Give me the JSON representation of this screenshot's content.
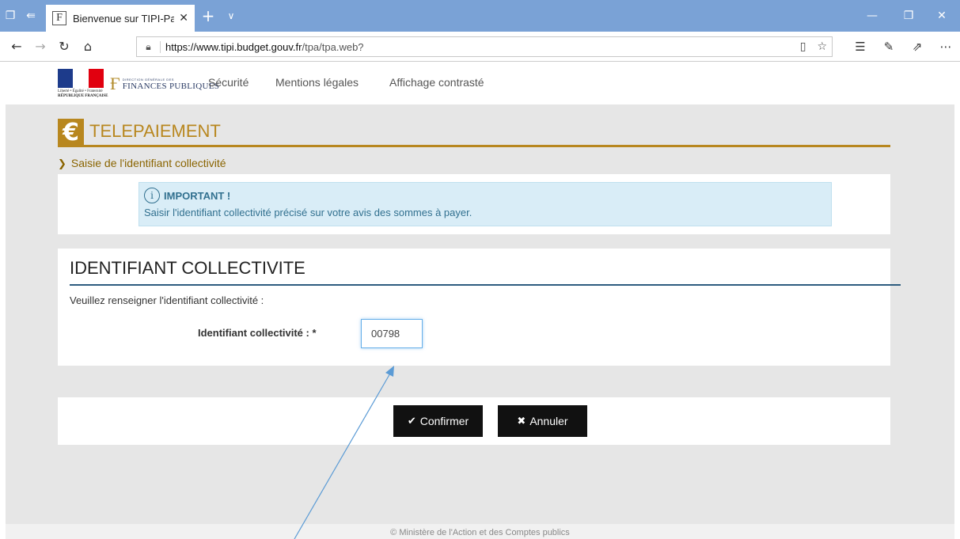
{
  "browser": {
    "tab_title": "Bienvenue sur TIPI-Paie",
    "tab_favicon": "F",
    "url_host": "https://www.tipi.budget.gouv.fr",
    "url_path": "/tpa/tpa.web?"
  },
  "header": {
    "logo_rf_line1": "Liberté • Égalité • Fraternité",
    "logo_rf_line2": "RÉPUBLIQUE FRANÇAISE",
    "logo_fp_small": "DIRECTION GÉNÉRALE DES",
    "logo_fp_big": "FINANCES PUBLIQUES",
    "nav": [
      "Sécurité",
      "Mentions légales",
      "Affichage contrasté"
    ]
  },
  "page": {
    "euro_symbol": "€",
    "title": "TELEPAIEMENT",
    "breadcrumb": "Saisie de l'identifiant collectivité"
  },
  "alert": {
    "icon_letter": "i",
    "heading": "IMPORTANT !",
    "body": "Saisir l'identifiant collectivité précisé sur votre avis des sommes à payer."
  },
  "form": {
    "title": "IDENTIFIANT COLLECTIVITE",
    "intro": "Veuillez renseigner l'identifiant collectivité :",
    "label": "Identifiant collectivité :  *",
    "value": "00798"
  },
  "actions": {
    "confirm_label": "Confirmer",
    "cancel_label": "Annuler"
  },
  "footer": {
    "text": "© Ministère de l'Action et des Comptes publics"
  },
  "colors": {
    "accent_gold": "#b8871f",
    "alert_bg": "#d9edf7",
    "rule_blue": "#2d5c7f",
    "chrome_blue": "#7aa2d6",
    "annotation_arrow": "#5b9bd5"
  }
}
